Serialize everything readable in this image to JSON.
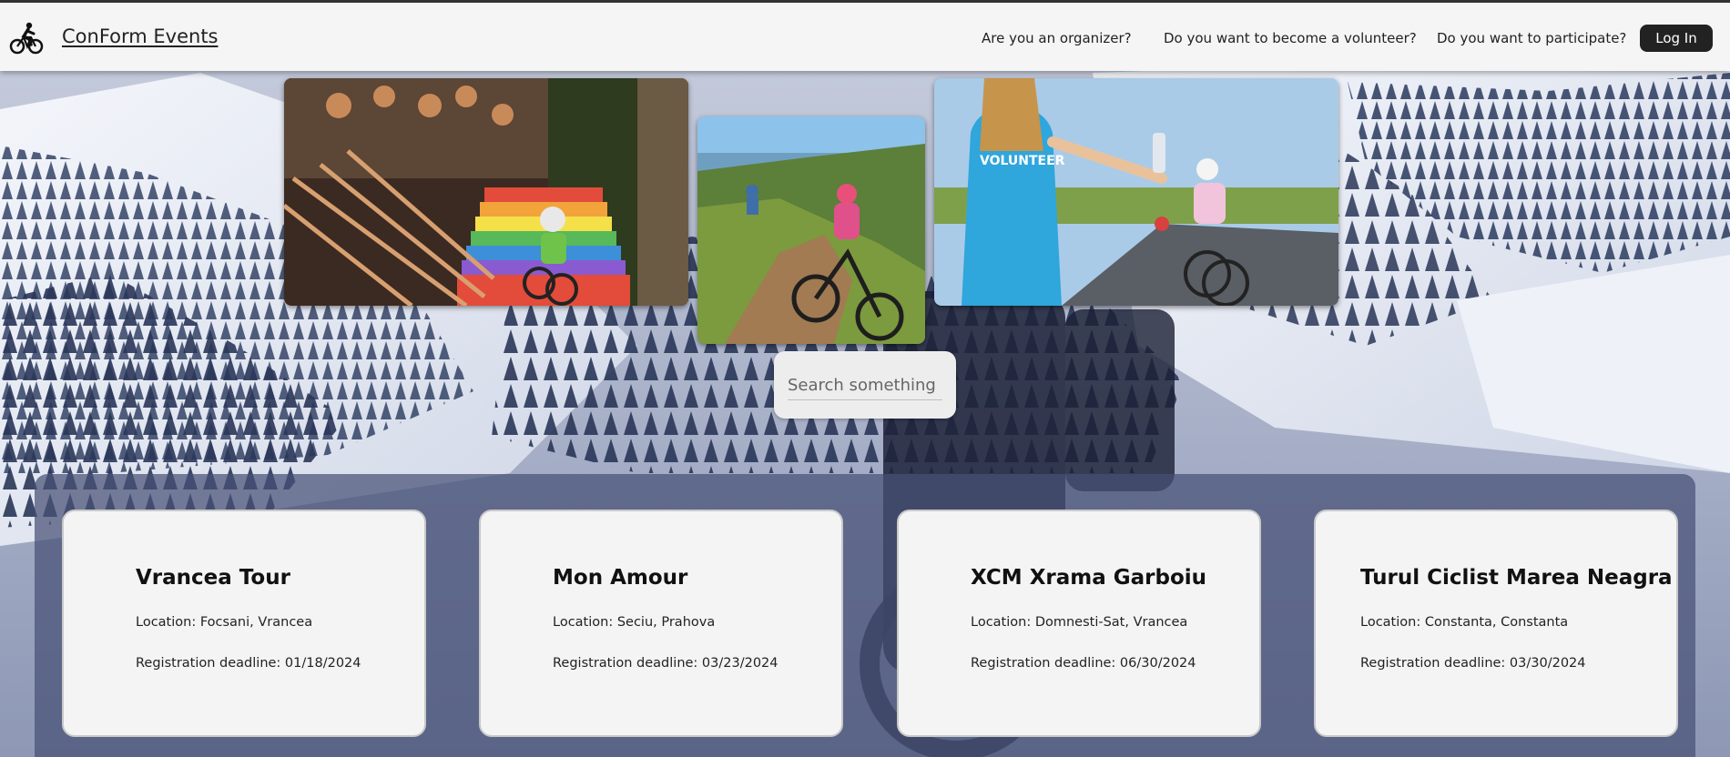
{
  "brand": {
    "name": "ConForm Events",
    "icon": "cyclist-icon"
  },
  "nav": {
    "organizer": "Are you an organizer?",
    "volunteer": "Do you want to become a volunteer?",
    "participate": "Do you want to participate?",
    "login": "Log In"
  },
  "photos": [
    {
      "icon": "downhill-race-photo"
    },
    {
      "icon": "mountain-trail-photo"
    },
    {
      "icon": "volunteer-water-photo"
    }
  ],
  "search": {
    "placeholder": "Search something",
    "value": ""
  },
  "events": [
    {
      "title": "Vrancea Tour",
      "location": "Location: Focsani, Vrancea",
      "deadline": "Registration deadline: 01/18/2024"
    },
    {
      "title": "Mon Amour",
      "location": "Location: Seciu, Prahova",
      "deadline": "Registration deadline: 03/23/2024"
    },
    {
      "title": "XCM Xrama Garboiu",
      "location": "Location: Domnesti-Sat, Vrancea",
      "deadline": "Registration deadline: 06/30/2024"
    },
    {
      "title": "Turul Ciclist Marea Neagra",
      "location": "Location: Constanta, Constanta",
      "deadline": "Registration deadline: 03/30/2024"
    }
  ],
  "colors": {
    "navbar": "#f5f5f5",
    "login_button": "#222222",
    "card": "#f4f4f4",
    "panel": "#465076"
  }
}
